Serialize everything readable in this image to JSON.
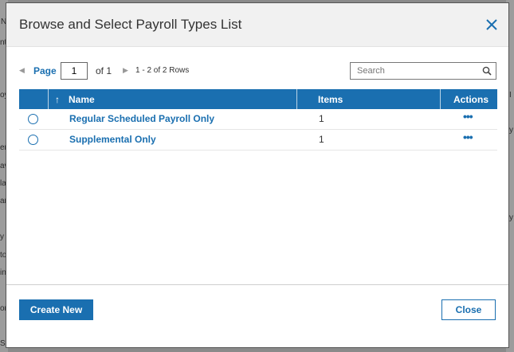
{
  "background": {
    "left_fragments": [
      "N",
      "nt",
      "oy",
      "er",
      "av",
      "la",
      "ar",
      "y",
      "to",
      "ine",
      "on",
      "Stc"
    ],
    "right_fragments": [
      "I",
      "y",
      "y"
    ]
  },
  "modal": {
    "title": "Browse and Select Payroll Types List",
    "close_icon": "close-icon"
  },
  "pager": {
    "page_label": "Page",
    "page_value": "1",
    "of_label": "of 1",
    "rows_label": "1 - 2 of 2 Rows"
  },
  "search": {
    "placeholder": "Search"
  },
  "table": {
    "columns": {
      "name": "Name",
      "items": "Items",
      "actions": "Actions"
    },
    "rows": [
      {
        "name": "Regular Scheduled Payroll Only",
        "items": "1",
        "actions": "•••"
      },
      {
        "name": "Supplemental Only",
        "items": "1",
        "actions": "•••"
      }
    ]
  },
  "footer": {
    "create_label": "Create New",
    "close_label": "Close"
  },
  "colors": {
    "accent": "#1a6fb0",
    "header_bg": "#f1f1f1"
  }
}
